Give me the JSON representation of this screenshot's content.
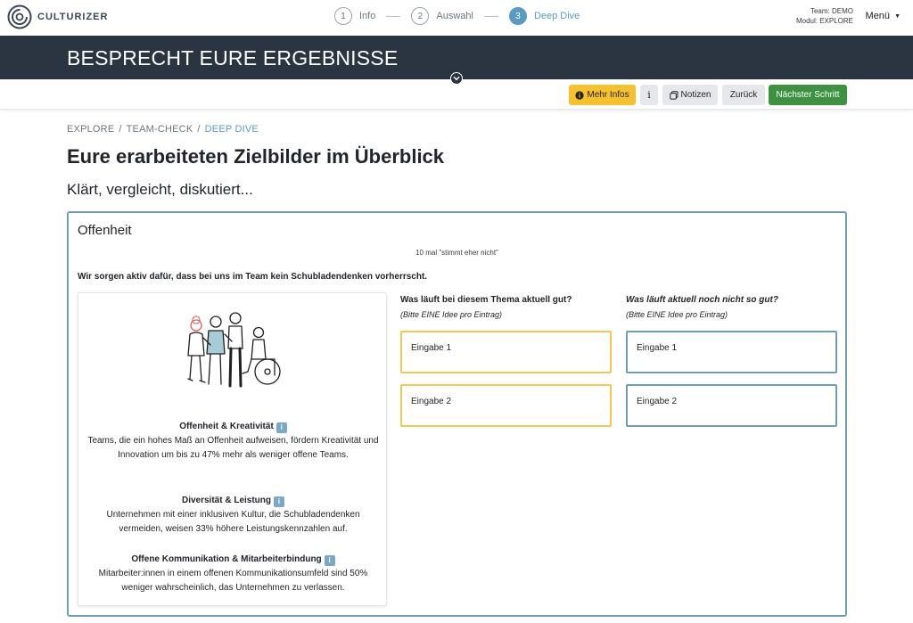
{
  "app": {
    "brand": "CULTURIZER"
  },
  "stepper": [
    {
      "num": "1",
      "label": "Info",
      "active": false
    },
    {
      "num": "2",
      "label": "Auswahl",
      "active": false
    },
    {
      "num": "3",
      "label": "Deep Dive",
      "active": true
    }
  ],
  "team": {
    "team_line": "Team: DEMO",
    "module_line": "Modul: EXPLORE"
  },
  "menu_label": "Menü",
  "hero": {
    "title": "BESPRECHT EURE ERGEBNISSE"
  },
  "toolbar": {
    "info_label": "Mehr Infos",
    "i_label": "i",
    "notes_label": "Notizen",
    "back_label": "Zurück",
    "next_label": "Nächster Schritt"
  },
  "breadcrumb": {
    "items": [
      "EXPLORE",
      "TEAM-CHECK",
      "DEEP DIVE"
    ],
    "separator": "/"
  },
  "page": {
    "title": "Eure erarbeiteten Zielbilder im Überblick",
    "subtitle": "Klärt, vergleicht, diskutiert..."
  },
  "card": {
    "title": "Offenheit",
    "count": "10 mal \"stimmt eher nicht\"",
    "statement": "Wir sorgen aktiv dafür, dass bei uns im Team kein Schubladendenken vorherrscht."
  },
  "facts": [
    {
      "title": "Offenheit & Kreativität",
      "text": "Teams, die ein hohes Maß an Offenheit aufweisen, fördern Kreativität und Innovation um bis zu 47% mehr als weniger offene Teams."
    },
    {
      "title": "Diversität & Leistung",
      "text": "Unternehmen mit einer inklusiven Kultur, die Schubladendenken vermeiden, weisen 33% höhere Leistungskennzahlen auf."
    },
    {
      "title": "Offene Kommunikation & Mitarbeiterbindung",
      "text": "Mitarbeiter:innen in einem offenen Kommunikationsumfeld sind 50% weniger wahrscheinlich, das Unternehmen zu verlassen."
    }
  ],
  "columns": {
    "good": {
      "heading": "Was läuft bei diesem Thema aktuell gut?",
      "hint": "(Bitte EINE Idee pro Eintrag)",
      "entries": [
        "Eingabe 1",
        "Eingabe 2"
      ]
    },
    "bad": {
      "heading": "Was läuft aktuell noch nicht so gut?",
      "hint": "(Bitte EINE Idee pro Eintrag)",
      "entries": [
        "Eingabe 1",
        "Eingabe 2"
      ]
    }
  },
  "colors": {
    "hero_bg": "#2a3541",
    "accent_blue": "#5a9bc1",
    "info_yellow": "#f6c12c",
    "next_green": "#3e9140",
    "good_border": "#f2c94c",
    "bad_border": "#6e9db8"
  },
  "icons": [
    "culturizer-logo-icon",
    "chevron-down-icon",
    "info-circle-icon",
    "notes-icon",
    "info-badge-icon",
    "caret-down-icon"
  ]
}
